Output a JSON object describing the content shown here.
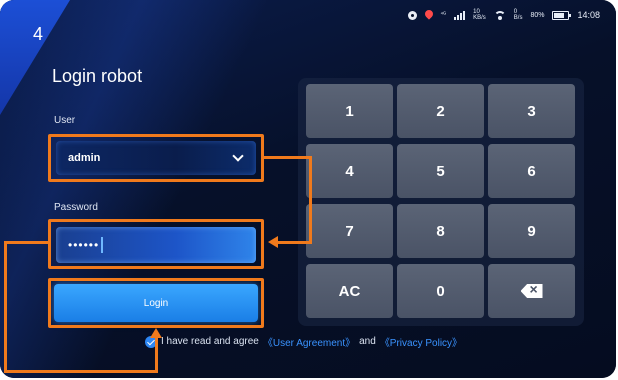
{
  "step": "4",
  "status_bar": {
    "signal": "⁴ᴳ",
    "net_speed_1": "10",
    "net_speed_1_unit": "KB/s",
    "net_speed_2": "0",
    "net_speed_2_unit": "B/s",
    "battery": "80%",
    "time": "14:08"
  },
  "login": {
    "title": "Login robot",
    "user_label": "User",
    "user_value": "admin",
    "password_label": "Password",
    "password_value": "••••••",
    "login_button": "Login"
  },
  "agreement": {
    "prefix": "I have read and agree",
    "link1": "《User Agreement》",
    "and": "and",
    "link2": "《Privacy Policy》"
  },
  "keypad": {
    "keys": [
      "1",
      "2",
      "3",
      "4",
      "5",
      "6",
      "7",
      "8",
      "9",
      "AC",
      "0"
    ]
  },
  "colors": {
    "highlight": "#f07a1c",
    "accent": "#2d86f3",
    "background": "#061029"
  }
}
